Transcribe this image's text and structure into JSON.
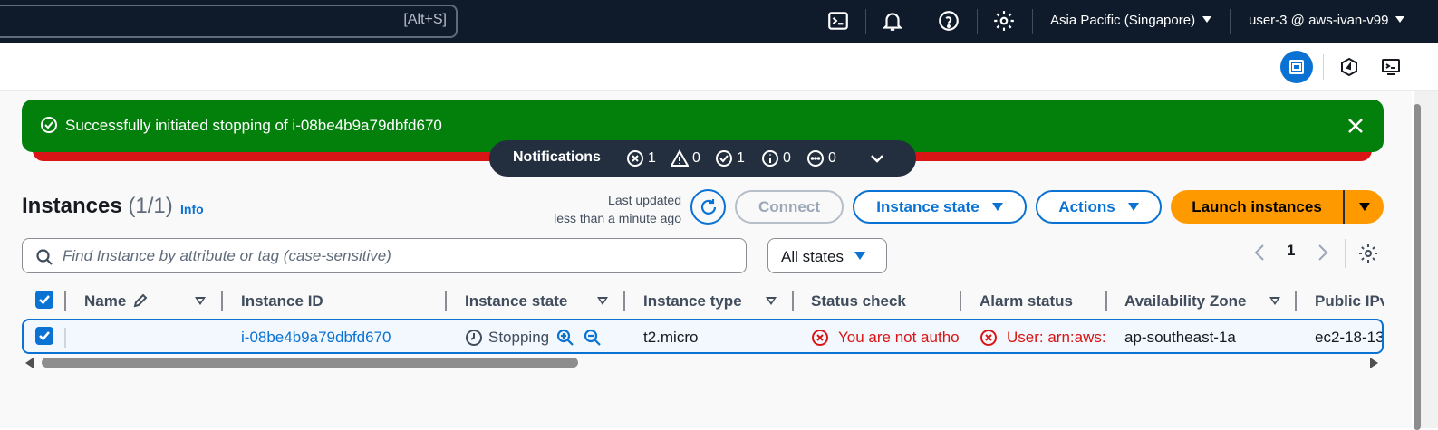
{
  "topnav": {
    "search_shortcut": "[Alt+S]",
    "icons": [
      "cloudshell-icon",
      "bell-icon",
      "help-icon",
      "gear-icon"
    ],
    "region": "Asia Pacific (Singapore)",
    "account": "user-3 @ aws-ivan-v99"
  },
  "flash": {
    "message": "Successfully initiated stopping of i-08be4b9a79dbfd670",
    "status_color": "#037f0c",
    "error_color": "#d91515"
  },
  "notifications": {
    "title": "Notifications",
    "errors": "1",
    "warnings": "0",
    "success": "1",
    "info": "0",
    "in_progress": "0"
  },
  "header": {
    "title": "Instances",
    "count": "(1/1)",
    "info": "Info",
    "last_updated_label": "Last updated",
    "last_updated_value": "less than a minute ago",
    "connect": "Connect",
    "instance_state": "Instance state",
    "actions": "Actions",
    "launch": "Launch instances"
  },
  "filter": {
    "placeholder": "Find Instance by attribute or tag (case-sensitive)",
    "states": "All states",
    "page": "1"
  },
  "table": {
    "columns": [
      "Name",
      "Instance ID",
      "Instance state",
      "Instance type",
      "Status check",
      "Alarm status",
      "Availability Zone",
      "Public IPv"
    ],
    "rows": [
      {
        "name": "",
        "instance_id": "i-08be4b9a79dbfd670",
        "state": "Stopping",
        "type": "t2.micro",
        "status_check": "You are not autho",
        "alarm_status": "User: arn:aws:i",
        "az": "ap-southeast-1a",
        "public_ip": "ec2-18-13"
      }
    ]
  },
  "colors": {
    "accent": "#0972d3",
    "primary": "#ff9900",
    "nav_bg": "#0f1b2a"
  }
}
